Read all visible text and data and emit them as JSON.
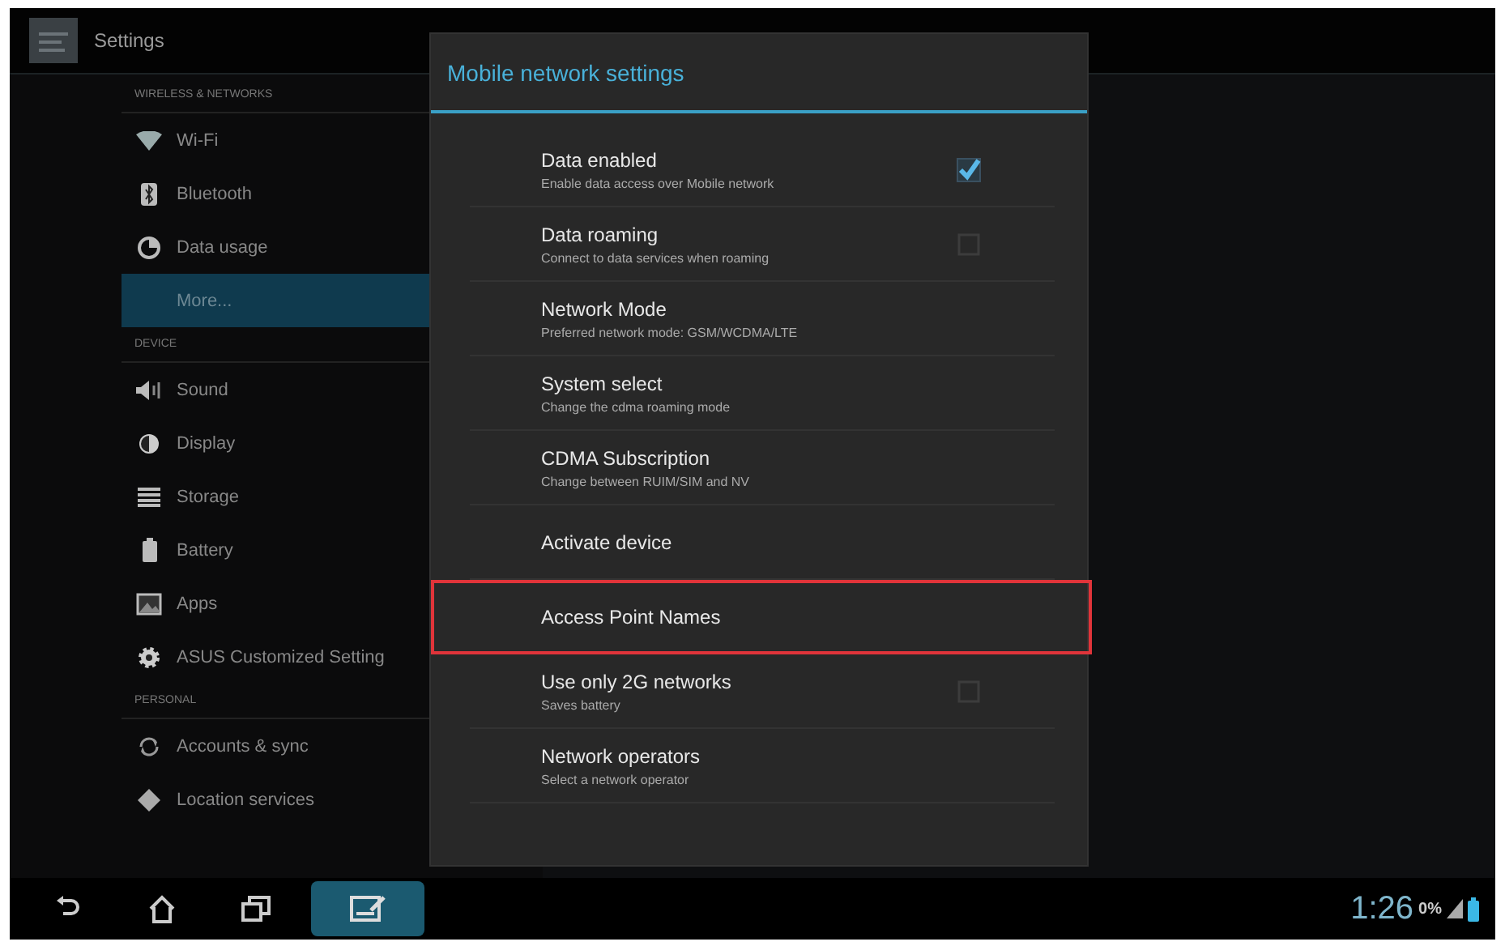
{
  "top_bar": {
    "title": "Settings"
  },
  "sidebar": {
    "sections": [
      {
        "header": "WIRELESS & NETWORKS",
        "items": [
          {
            "label": "Wi-Fi",
            "selected": false
          },
          {
            "label": "Bluetooth",
            "selected": false
          },
          {
            "label": "Data usage",
            "selected": false
          },
          {
            "label": "More...",
            "selected": true
          }
        ]
      },
      {
        "header": "DEVICE",
        "items": [
          {
            "label": "Sound",
            "selected": false
          },
          {
            "label": "Display",
            "selected": false
          },
          {
            "label": "Storage",
            "selected": false
          },
          {
            "label": "Battery",
            "selected": false
          },
          {
            "label": "Apps",
            "selected": false
          },
          {
            "label": "ASUS Customized Setting",
            "selected": false
          }
        ]
      },
      {
        "header": "PERSONAL",
        "items": [
          {
            "label": "Accounts & sync",
            "selected": false
          },
          {
            "label": "Location services",
            "selected": false
          }
        ]
      }
    ]
  },
  "dialog": {
    "title": "Mobile network settings",
    "items": [
      {
        "kind": "checkbox",
        "title": "Data enabled",
        "subtitle": "Enable data access over Mobile network",
        "checked": true,
        "highlighted": false
      },
      {
        "kind": "checkbox",
        "title": "Data roaming",
        "subtitle": "Connect to data services when roaming",
        "checked": false,
        "highlighted": false
      },
      {
        "kind": "option",
        "title": "Network Mode",
        "subtitle": "Preferred network mode: GSM/WCDMA/LTE",
        "highlighted": false
      },
      {
        "kind": "option",
        "title": "System select",
        "subtitle": "Change the cdma roaming mode",
        "highlighted": false
      },
      {
        "kind": "option",
        "title": "CDMA Subscription",
        "subtitle": "Change between RUIM/SIM and NV",
        "highlighted": false
      },
      {
        "kind": "option",
        "title": "Activate device",
        "highlighted": false
      },
      {
        "kind": "option",
        "title": "Access Point Names",
        "highlighted": true
      },
      {
        "kind": "checkbox",
        "title": "Use only 2G networks",
        "subtitle": "Saves battery",
        "checked": false,
        "highlighted": false
      },
      {
        "kind": "option",
        "title": "Network operators",
        "subtitle": "Select a network operator",
        "highlighted": false
      }
    ]
  },
  "nav_bar": {
    "buttons": [
      {
        "selected": false
      },
      {
        "selected": false
      },
      {
        "selected": false
      },
      {
        "selected": true
      }
    ],
    "clock": "1:26",
    "data_indicator": "0%"
  }
}
